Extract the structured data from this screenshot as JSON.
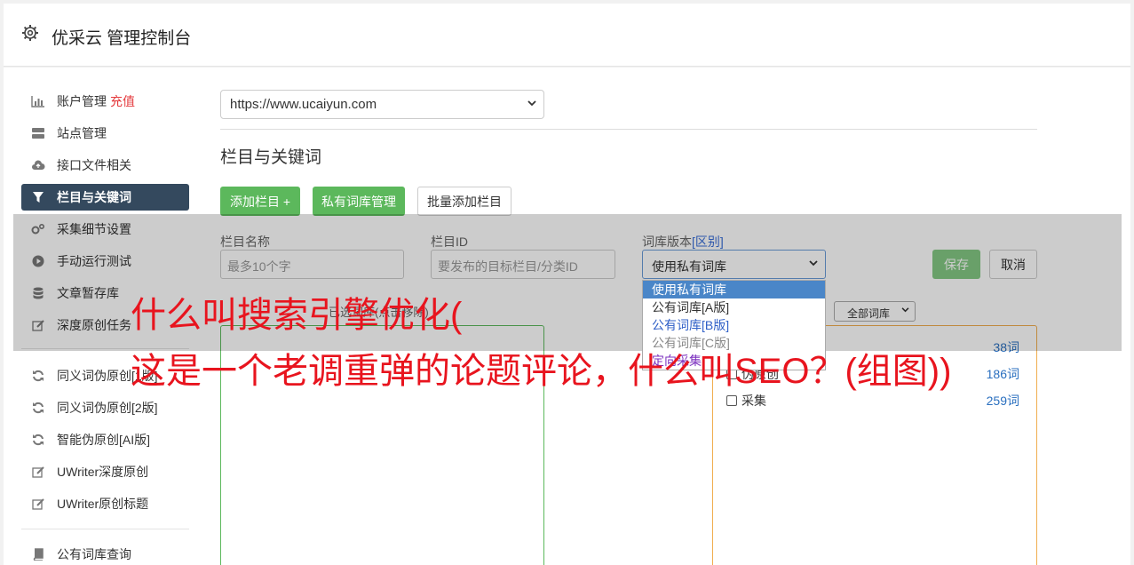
{
  "header": {
    "title": "优采云 管理控制台"
  },
  "sidebar": {
    "items": [
      {
        "label": "账户管理",
        "badge": "充值",
        "icon": "bar-chart-icon"
      },
      {
        "label": "站点管理",
        "icon": "server-icon"
      },
      {
        "label": "接口文件相关",
        "icon": "cloud-upload-icon"
      },
      {
        "label": "栏目与关键词",
        "icon": "filter-icon",
        "active": true
      },
      {
        "label": "采集细节设置",
        "icon": "cogs-icon"
      },
      {
        "label": "手动运行测试",
        "icon": "play-circle-icon"
      },
      {
        "label": "文章暂存库",
        "icon": "database-icon"
      },
      {
        "label": "深度原创任务",
        "icon": "edit-icon"
      },
      {
        "label": "同义词伪原创[1版]",
        "icon": "refresh-icon"
      },
      {
        "label": "同义词伪原创[2版]",
        "icon": "refresh-icon"
      },
      {
        "label": "智能伪原创[AI版]",
        "icon": "refresh-icon"
      },
      {
        "label": "UWriter深度原创",
        "icon": "edit-icon"
      },
      {
        "label": "UWriter原创标题",
        "icon": "edit-icon"
      },
      {
        "label": "公有词库查询",
        "icon": "book-icon"
      }
    ]
  },
  "site_select": {
    "value": "https://www.ucaiyun.com"
  },
  "section_title": "栏目与关键词",
  "toolbar": {
    "add_column": "添加栏目 +",
    "private_lib": "私有词库管理",
    "batch_add": "批量添加栏目"
  },
  "form": {
    "name_label": "栏目名称",
    "name_placeholder": "最多10个字",
    "id_label": "栏目ID",
    "id_placeholder": "要发布的目标栏目/分类ID",
    "lib_label": "词库版本",
    "lib_label_hint": "[区别]",
    "lib_value": "使用私有词库",
    "save": "保存",
    "cancel": "取消"
  },
  "dropdown": {
    "options": [
      "使用私有词库",
      "公有词库[A版]",
      "公有词库[B版]",
      "公有词库[C版]",
      "定向采集"
    ]
  },
  "left_hint": "已选词库(点击移除)",
  "filter": {
    "value": "全部词库"
  },
  "libraries": [
    {
      "name": "",
      "count": "38词"
    },
    {
      "name": "伪原创",
      "count": "186词"
    },
    {
      "name": "采集",
      "count": "259词"
    }
  ],
  "overlay_text": {
    "line1": "什么叫搜索引擎优化(",
    "line2": "这是一个老调重弹的论题评论，什么叫SEO？(组图))"
  },
  "colors": {
    "accent_green": "#5cb85c",
    "active_nav": "#34495e",
    "overlay_red": "#e8141e",
    "badge_red": "#e4393c"
  }
}
